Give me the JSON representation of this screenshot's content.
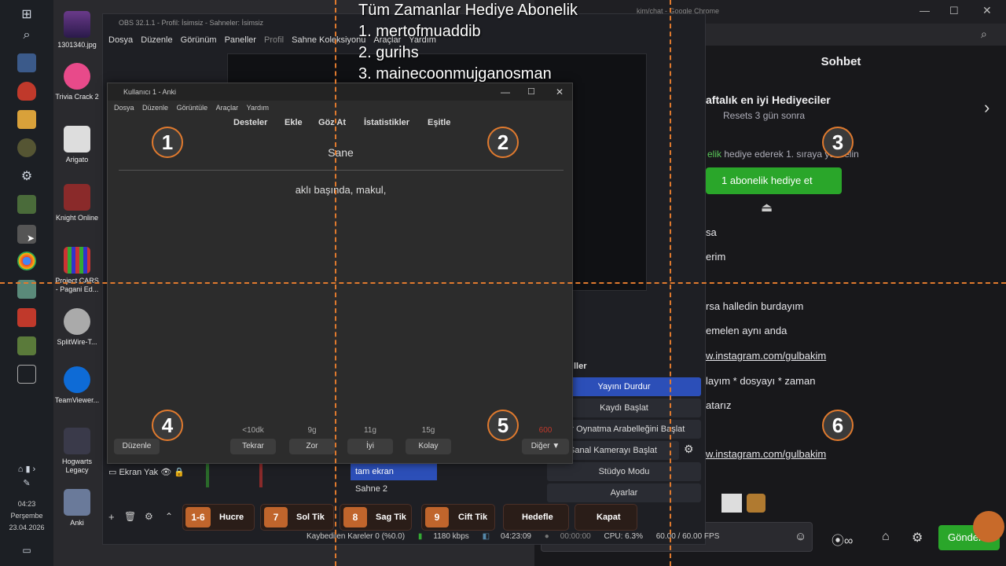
{
  "taskbar": {
    "time": "04:23",
    "day": "Perşembe",
    "date": "23.04.2026"
  },
  "desktop_icons": [
    {
      "label": "1301340.jpg"
    },
    {
      "label": "Trivia Crack 2"
    },
    {
      "label": "Arigato"
    },
    {
      "label": "Knight Online"
    },
    {
      "label": "Project CARS - Pagani Ed..."
    },
    {
      "label": "SplitWire-T..."
    },
    {
      "label": "TeamViewer..."
    },
    {
      "label": "Hogwarts Legacy"
    },
    {
      "label": "Anki"
    }
  ],
  "chrome": {
    "title_fragment": "kim/chat - Google Chrome",
    "chat_header": "Sohbet",
    "gift_title": "aftalık en iyi Hediyeciler",
    "gift_reset": "Resets 3 gün sonra",
    "gift_line_green": "elik",
    "gift_line_rest": " hediye ederek 1. sıraya yükselin",
    "gift_button": "1 abonelik hediye et",
    "messages": [
      "sa",
      "erim",
      "rsa halledin burdayım",
      "emelen aynı anda",
      "w.instagram.com/gulbakim",
      "layım * dosyayı * zaman",
      "atarız",
      "w.instagram.com/gulbakim"
    ],
    "send_button": "Gönder"
  },
  "obs": {
    "title": "OBS 32.1.1 - Profil: İsimsiz - Sahneler: İsimsiz",
    "menu": [
      "Dosya",
      "Düzenle",
      "Görünüm",
      "Paneller",
      "Profil",
      "Sahne Koleksiyonu",
      "Araçlar",
      "Yardım"
    ],
    "controls_title": "ller",
    "controls": [
      "Yayını Durdur",
      "Kaydı Başlat",
      "rar Oynatma Arabelleğini Başlat",
      "Sanal Kamerayı Başlat",
      "Stüdyo Modu",
      "Ayarlar"
    ],
    "scenes": [
      "tam ekran",
      "Sahne 2"
    ],
    "source": "Ekran Yak",
    "status": {
      "dropped": "Kaybedilen Kareler 0 (%0.0)",
      "bitrate": "1180 kbps",
      "stream_time": "04:23:09",
      "rec_time": "00:00:00",
      "cpu": "CPU: 6.3%",
      "fps": "60.00 / 60.00 FPS"
    }
  },
  "anki": {
    "title": "Kullanıcı 1 - Anki",
    "menu": [
      "Dosya",
      "Düzenle",
      "Görüntüle",
      "Araçlar",
      "Yardım"
    ],
    "toolbar": [
      "Desteler",
      "Ekle",
      "Göz At",
      "İstatistikler",
      "Eşitle"
    ],
    "front": "Sane",
    "back": "aklı başında, makul,",
    "edit_button": "Düzenle",
    "answers": [
      {
        "interval": "<10dk",
        "label": "Tekrar"
      },
      {
        "interval": "9g",
        "label": "Zor"
      },
      {
        "interval": "11g",
        "label": "İyi"
      },
      {
        "interval": "15g",
        "label": "Kolay"
      }
    ],
    "remaining": "600",
    "more_button": "Diğer ▼"
  },
  "overlay": {
    "gift_header": "Tüm Zamanlar Hediye Abonelik",
    "top_gifters": [
      "1. mertofmuaddib",
      "2. gurihs",
      "3. mainecoonmujganosman"
    ]
  },
  "zones": [
    "1",
    "2",
    "3",
    "4",
    "5",
    "6"
  ],
  "hints": [
    {
      "key": "1-6",
      "label": "Hucre"
    },
    {
      "key": "7",
      "label": "Sol Tik"
    },
    {
      "key": "8",
      "label": "Sag Tik"
    },
    {
      "key": "9",
      "label": "Cift Tik"
    },
    {
      "key": "",
      "label": "Hedefle"
    },
    {
      "key": "",
      "label": "Kapat"
    }
  ],
  "colors": {
    "guide_orange": "#e07a2e",
    "twitch_green": "#2aa62a",
    "obs_blue": "#2c4fb8"
  }
}
